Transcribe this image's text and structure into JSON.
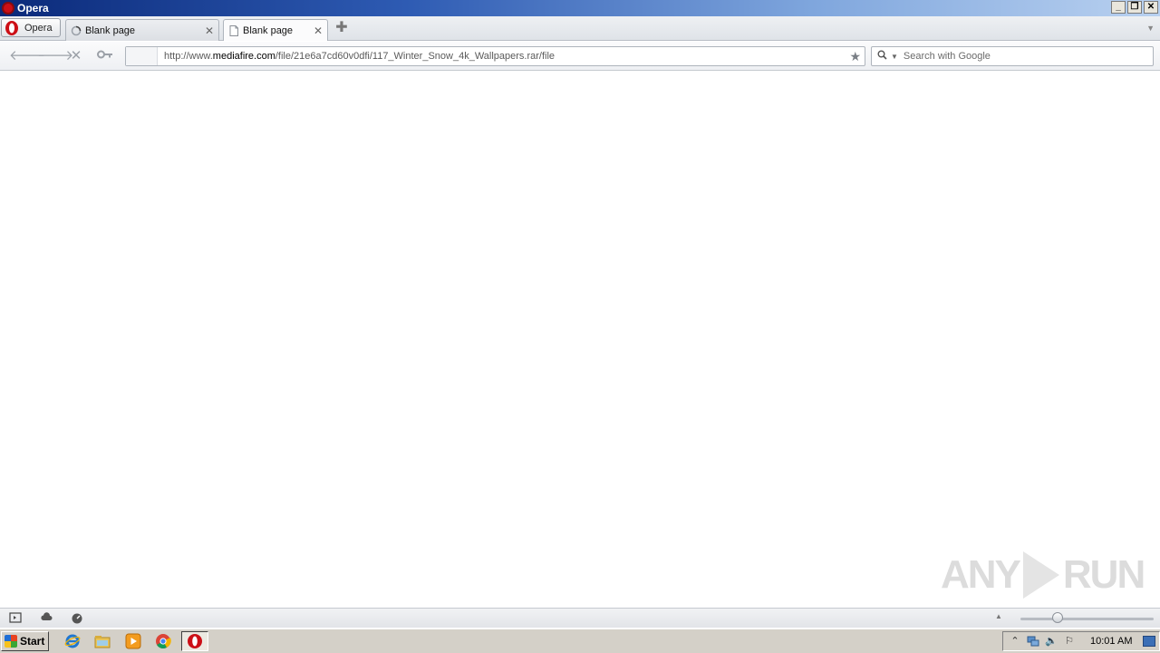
{
  "window": {
    "title": "Opera"
  },
  "window_buttons": {
    "minimize": "_",
    "restore": "❐",
    "close": "✕"
  },
  "opera_menu": {
    "label": "Opera"
  },
  "tabs": [
    {
      "label": "Blank page",
      "state": "loading"
    },
    {
      "label": "Blank page",
      "state": "active"
    }
  ],
  "address": {
    "url_prefix": "http://www.",
    "url_domain": "mediafire.com",
    "url_path": "/file/21e6a7cd60v0dfi/117_Winter_Snow_4k_Wallpapers.rar/file"
  },
  "search": {
    "placeholder": "Search with Google",
    "value": ""
  },
  "watermark": {
    "left": "ANY",
    "right": "RUN"
  },
  "taskbar": {
    "start_label": "Start",
    "clock": "10:01 AM"
  },
  "colors": {
    "title_gradient_start": "#0b2a7a",
    "opera_red": "#cc0f16",
    "taskbar": "#d4d0c8"
  }
}
